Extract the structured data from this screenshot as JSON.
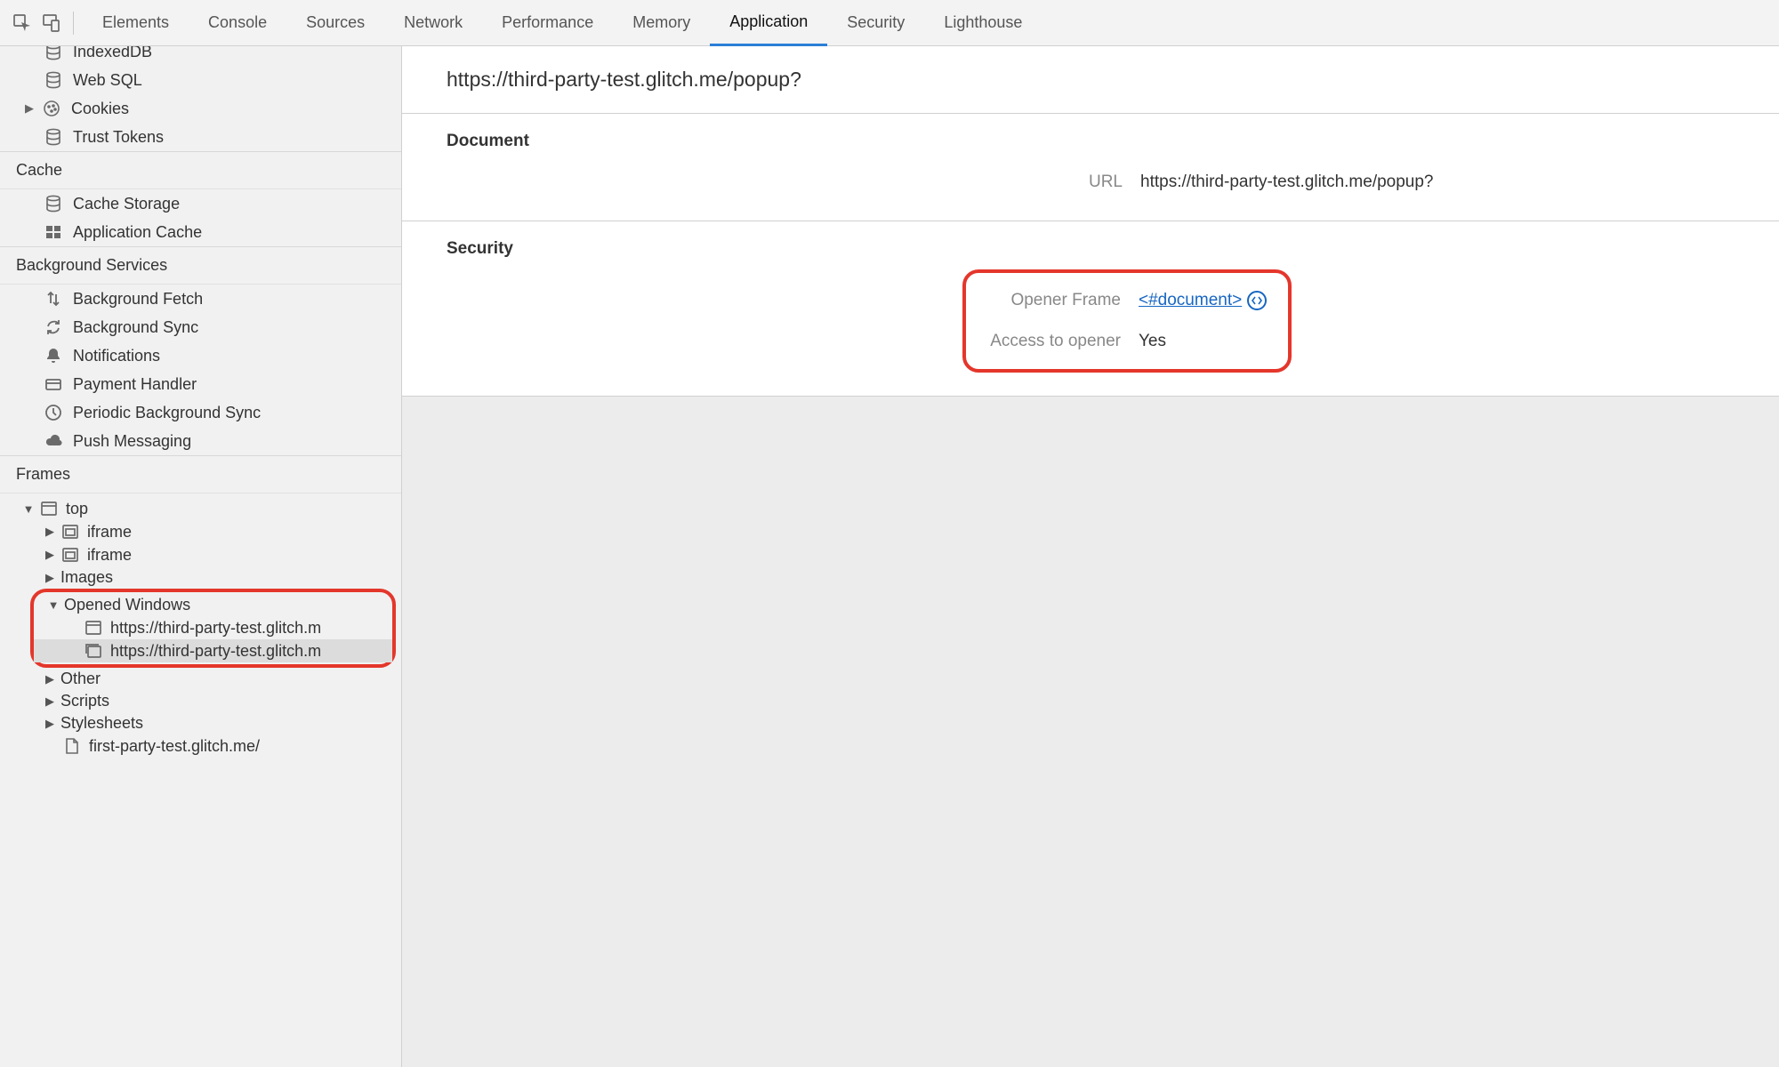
{
  "tabs": {
    "elements": "Elements",
    "console": "Console",
    "sources": "Sources",
    "network": "Network",
    "performance": "Performance",
    "memory": "Memory",
    "application": "Application",
    "security": "Security",
    "lighthouse": "Lighthouse"
  },
  "sidebar": {
    "storage": {
      "indexeddb": "IndexedDB",
      "websql": "Web SQL",
      "cookies": "Cookies",
      "trust_tokens": "Trust Tokens"
    },
    "cache_heading": "Cache",
    "cache": {
      "cache_storage": "Cache Storage",
      "application_cache": "Application Cache"
    },
    "bg_heading": "Background Services",
    "bg": {
      "background_fetch": "Background Fetch",
      "background_sync": "Background Sync",
      "notifications": "Notifications",
      "payment_handler": "Payment Handler",
      "periodic_background_sync": "Periodic Background Sync",
      "push_messaging": "Push Messaging"
    },
    "frames_heading": "Frames",
    "frames": {
      "top": "top",
      "iframe1": "iframe",
      "iframe2": "iframe",
      "images": "Images",
      "opened_windows": "Opened Windows",
      "window1": "https://third-party-test.glitch.m",
      "window2": "https://third-party-test.glitch.m",
      "other": "Other",
      "scripts": "Scripts",
      "stylesheets": "Stylesheets",
      "stylesheet1": "first-party-test.glitch.me/"
    }
  },
  "main": {
    "title": "https://third-party-test.glitch.me/popup?",
    "document_heading": "Document",
    "document": {
      "url_label": "URL",
      "url_value": "https://third-party-test.glitch.me/popup?"
    },
    "security_heading": "Security",
    "security": {
      "opener_frame_label": "Opener Frame",
      "opener_frame_value": "<#document>",
      "access_label": "Access to opener",
      "access_value": "Yes"
    }
  }
}
